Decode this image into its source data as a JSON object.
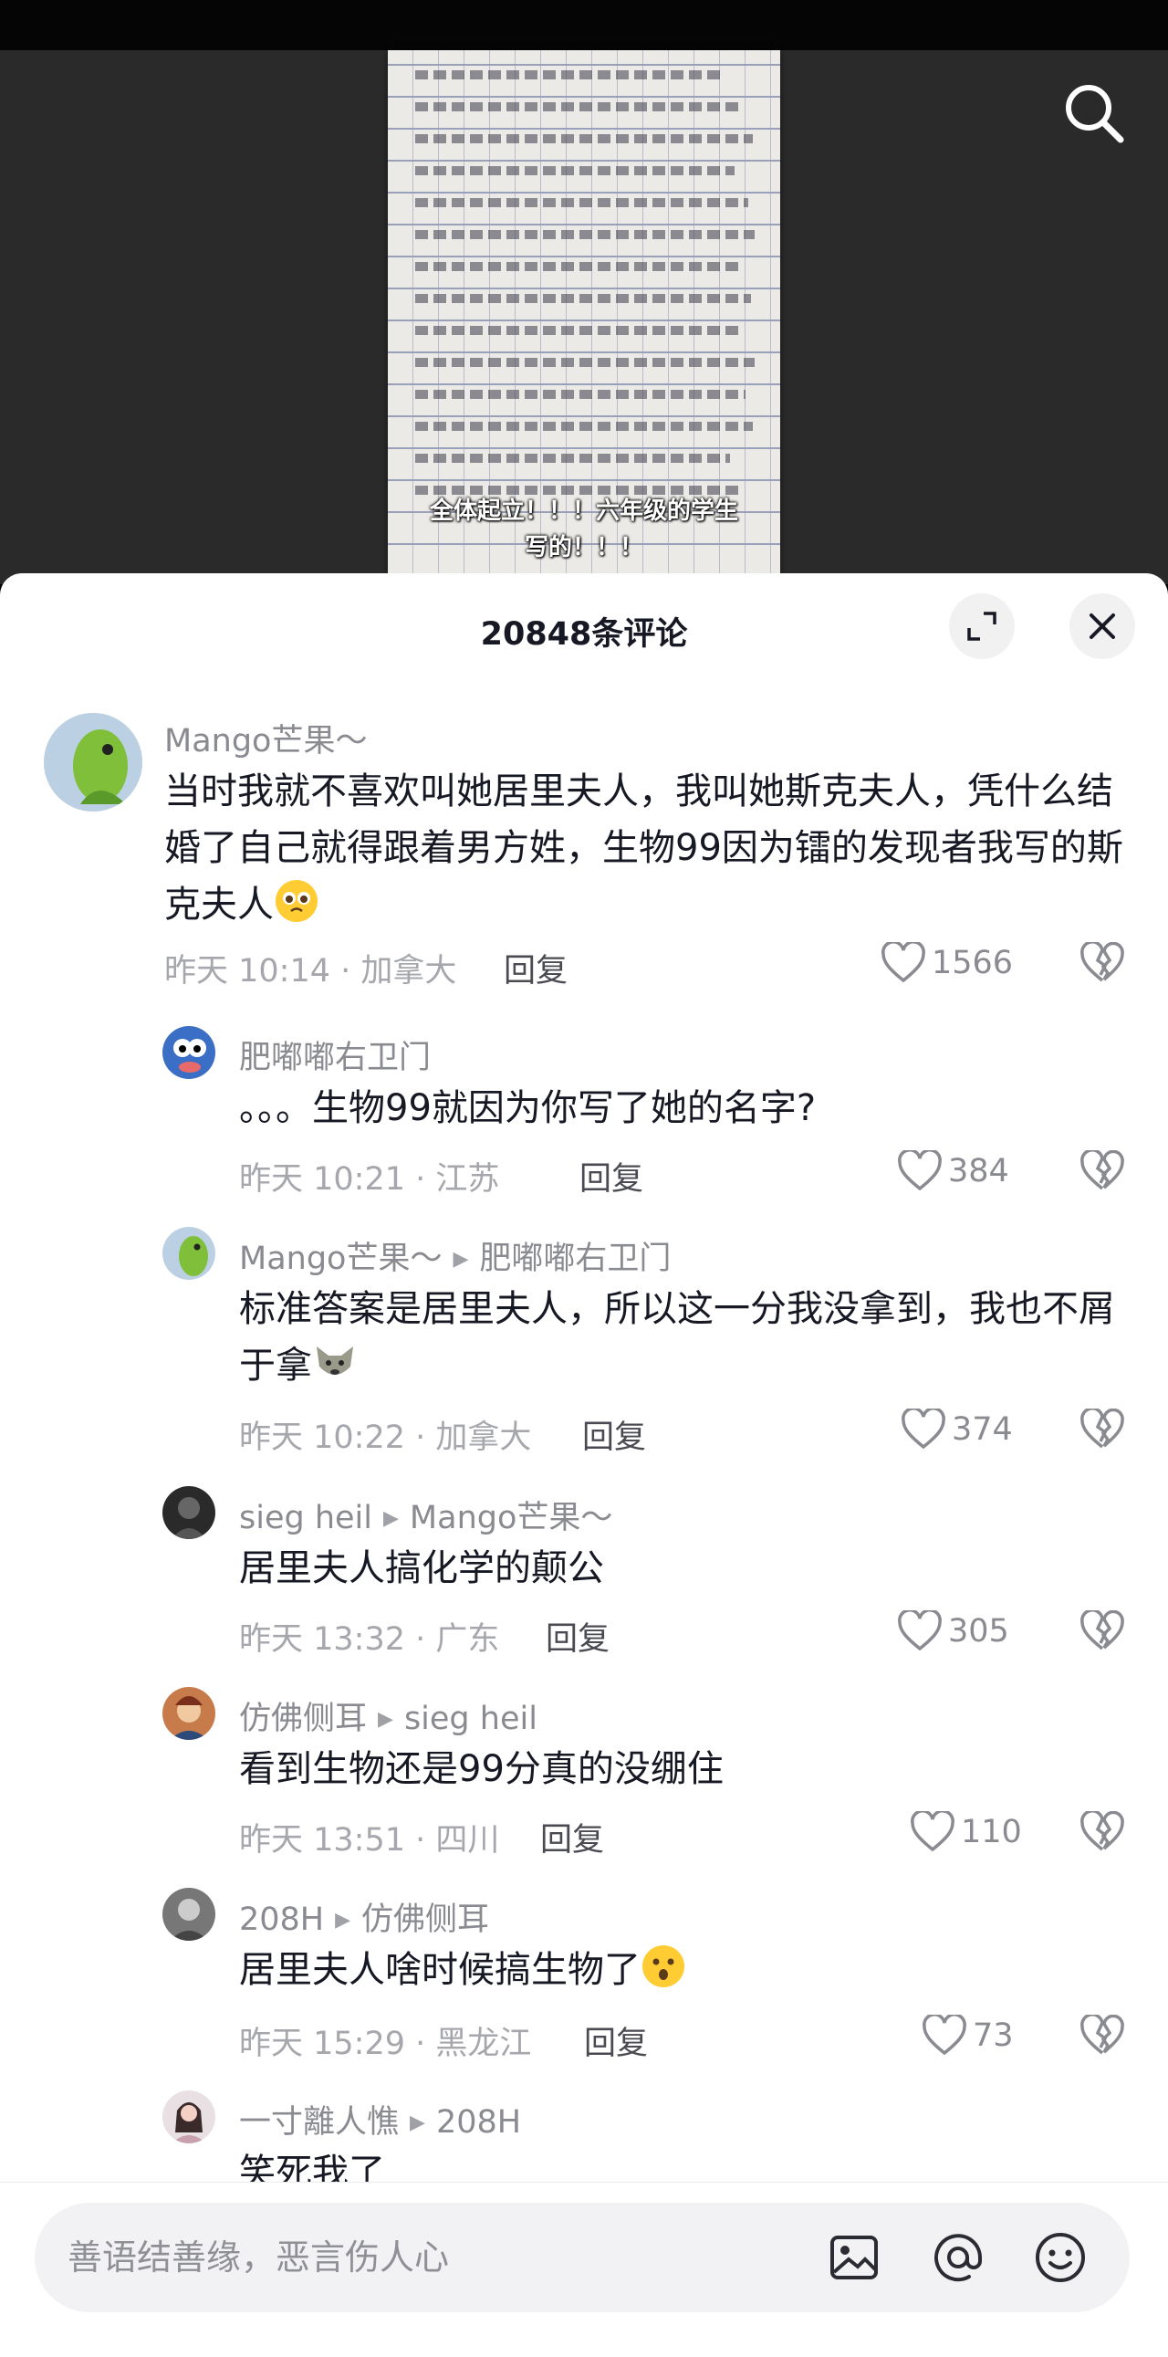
{
  "video": {
    "caption_line1": "全体起立！！！六年级的学生",
    "caption_line2": "写的！！！"
  },
  "sheet": {
    "title": "20848条评论"
  },
  "comments": [
    {
      "author": "Mango芒果～",
      "reply_to": "",
      "text": "当时我就不喜欢叫她居里夫人，我叫她斯克夫人，凭什么结婚了自己就得跟着男方姓，生物99因为镭的发现者我写的斯克夫人",
      "emoji": "pleading-face",
      "time": "昨天 10:14",
      "location": "加拿大",
      "reply_label": "回复",
      "likes": "1566"
    },
    {
      "author": "肥嘟嘟右卫门",
      "reply_to": "",
      "text": "。。。生物99就因为你写了她的名字?",
      "time": "昨天 10:21",
      "location": "江苏",
      "reply_label": "回复",
      "likes": "384"
    },
    {
      "author": "Mango芒果～",
      "reply_to": "肥嘟嘟右卫门",
      "text": "标准答案是居里夫人，所以这一分我没拿到，我也不屑于拿",
      "emoji": "wolf-face",
      "time": "昨天 10:22",
      "location": "加拿大",
      "reply_label": "回复",
      "likes": "374"
    },
    {
      "author": "sieg heil",
      "reply_to": "Mango芒果～",
      "text": "居里夫人搞化学的颠公",
      "time": "昨天 13:32",
      "location": "广东",
      "reply_label": "回复",
      "likes": "305"
    },
    {
      "author": "仿佛侧耳",
      "reply_to": "sieg heil",
      "text": "看到生物还是99分真的没绷住",
      "time": "昨天 13:51",
      "location": "四川",
      "reply_label": "回复",
      "likes": "110"
    },
    {
      "author": "208H",
      "reply_to": "仿佛侧耳",
      "text": "居里夫人啥时候搞生物了",
      "emoji": "astonished-face",
      "time": "昨天 15:29",
      "location": "黑龙江",
      "reply_label": "回复",
      "likes": "73"
    },
    {
      "author": "一寸離人憔",
      "reply_to": "208H",
      "text": "笑死我了"
    }
  ],
  "input": {
    "placeholder": "善语结善缘，恶言伤人心"
  },
  "icons": {
    "search": "search-icon",
    "expand": "expand-icon",
    "close": "close-icon",
    "like": "heart-outline-icon",
    "dislike": "broken-heart-icon",
    "image": "image-icon",
    "mention": "at-icon",
    "emoji": "emoji-icon"
  },
  "colors": {
    "text_primary": "#161823",
    "text_secondary": "#8a8b91",
    "sheet_bg": "#ffffff",
    "input_bg": "#f2f2f4"
  }
}
